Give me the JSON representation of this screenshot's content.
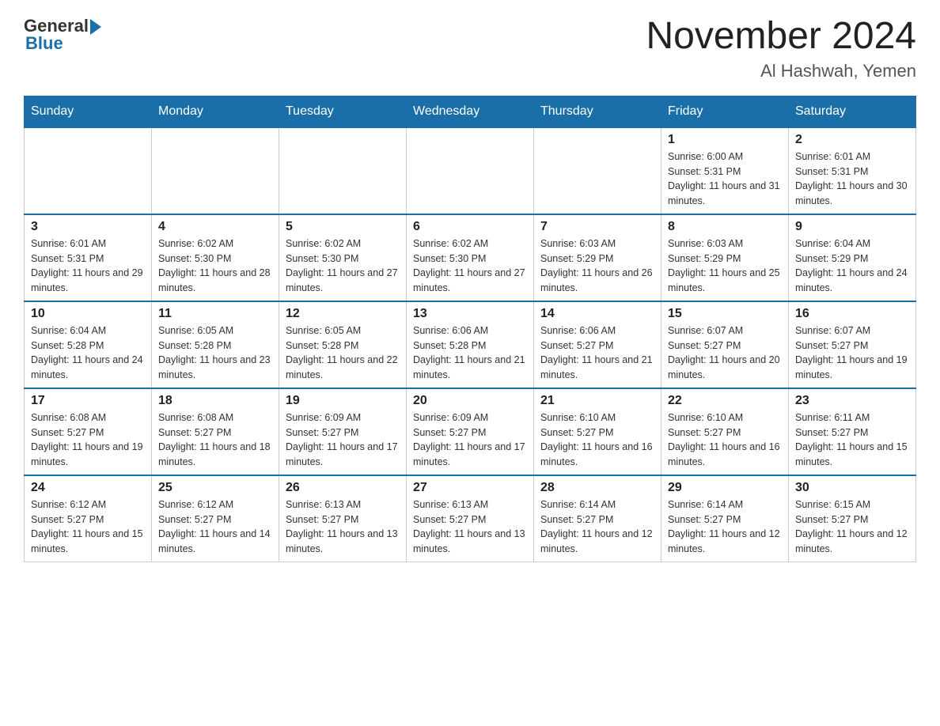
{
  "header": {
    "logo_general": "General",
    "logo_blue": "Blue",
    "title": "November 2024",
    "subtitle": "Al Hashwah, Yemen"
  },
  "days_of_week": [
    "Sunday",
    "Monday",
    "Tuesday",
    "Wednesday",
    "Thursday",
    "Friday",
    "Saturday"
  ],
  "weeks": [
    [
      {
        "day": "",
        "info": ""
      },
      {
        "day": "",
        "info": ""
      },
      {
        "day": "",
        "info": ""
      },
      {
        "day": "",
        "info": ""
      },
      {
        "day": "",
        "info": ""
      },
      {
        "day": "1",
        "info": "Sunrise: 6:00 AM\nSunset: 5:31 PM\nDaylight: 11 hours and 31 minutes."
      },
      {
        "day": "2",
        "info": "Sunrise: 6:01 AM\nSunset: 5:31 PM\nDaylight: 11 hours and 30 minutes."
      }
    ],
    [
      {
        "day": "3",
        "info": "Sunrise: 6:01 AM\nSunset: 5:31 PM\nDaylight: 11 hours and 29 minutes."
      },
      {
        "day": "4",
        "info": "Sunrise: 6:02 AM\nSunset: 5:30 PM\nDaylight: 11 hours and 28 minutes."
      },
      {
        "day": "5",
        "info": "Sunrise: 6:02 AM\nSunset: 5:30 PM\nDaylight: 11 hours and 27 minutes."
      },
      {
        "day": "6",
        "info": "Sunrise: 6:02 AM\nSunset: 5:30 PM\nDaylight: 11 hours and 27 minutes."
      },
      {
        "day": "7",
        "info": "Sunrise: 6:03 AM\nSunset: 5:29 PM\nDaylight: 11 hours and 26 minutes."
      },
      {
        "day": "8",
        "info": "Sunrise: 6:03 AM\nSunset: 5:29 PM\nDaylight: 11 hours and 25 minutes."
      },
      {
        "day": "9",
        "info": "Sunrise: 6:04 AM\nSunset: 5:29 PM\nDaylight: 11 hours and 24 minutes."
      }
    ],
    [
      {
        "day": "10",
        "info": "Sunrise: 6:04 AM\nSunset: 5:28 PM\nDaylight: 11 hours and 24 minutes."
      },
      {
        "day": "11",
        "info": "Sunrise: 6:05 AM\nSunset: 5:28 PM\nDaylight: 11 hours and 23 minutes."
      },
      {
        "day": "12",
        "info": "Sunrise: 6:05 AM\nSunset: 5:28 PM\nDaylight: 11 hours and 22 minutes."
      },
      {
        "day": "13",
        "info": "Sunrise: 6:06 AM\nSunset: 5:28 PM\nDaylight: 11 hours and 21 minutes."
      },
      {
        "day": "14",
        "info": "Sunrise: 6:06 AM\nSunset: 5:27 PM\nDaylight: 11 hours and 21 minutes."
      },
      {
        "day": "15",
        "info": "Sunrise: 6:07 AM\nSunset: 5:27 PM\nDaylight: 11 hours and 20 minutes."
      },
      {
        "day": "16",
        "info": "Sunrise: 6:07 AM\nSunset: 5:27 PM\nDaylight: 11 hours and 19 minutes."
      }
    ],
    [
      {
        "day": "17",
        "info": "Sunrise: 6:08 AM\nSunset: 5:27 PM\nDaylight: 11 hours and 19 minutes."
      },
      {
        "day": "18",
        "info": "Sunrise: 6:08 AM\nSunset: 5:27 PM\nDaylight: 11 hours and 18 minutes."
      },
      {
        "day": "19",
        "info": "Sunrise: 6:09 AM\nSunset: 5:27 PM\nDaylight: 11 hours and 17 minutes."
      },
      {
        "day": "20",
        "info": "Sunrise: 6:09 AM\nSunset: 5:27 PM\nDaylight: 11 hours and 17 minutes."
      },
      {
        "day": "21",
        "info": "Sunrise: 6:10 AM\nSunset: 5:27 PM\nDaylight: 11 hours and 16 minutes."
      },
      {
        "day": "22",
        "info": "Sunrise: 6:10 AM\nSunset: 5:27 PM\nDaylight: 11 hours and 16 minutes."
      },
      {
        "day": "23",
        "info": "Sunrise: 6:11 AM\nSunset: 5:27 PM\nDaylight: 11 hours and 15 minutes."
      }
    ],
    [
      {
        "day": "24",
        "info": "Sunrise: 6:12 AM\nSunset: 5:27 PM\nDaylight: 11 hours and 15 minutes."
      },
      {
        "day": "25",
        "info": "Sunrise: 6:12 AM\nSunset: 5:27 PM\nDaylight: 11 hours and 14 minutes."
      },
      {
        "day": "26",
        "info": "Sunrise: 6:13 AM\nSunset: 5:27 PM\nDaylight: 11 hours and 13 minutes."
      },
      {
        "day": "27",
        "info": "Sunrise: 6:13 AM\nSunset: 5:27 PM\nDaylight: 11 hours and 13 minutes."
      },
      {
        "day": "28",
        "info": "Sunrise: 6:14 AM\nSunset: 5:27 PM\nDaylight: 11 hours and 12 minutes."
      },
      {
        "day": "29",
        "info": "Sunrise: 6:14 AM\nSunset: 5:27 PM\nDaylight: 11 hours and 12 minutes."
      },
      {
        "day": "30",
        "info": "Sunrise: 6:15 AM\nSunset: 5:27 PM\nDaylight: 11 hours and 12 minutes."
      }
    ]
  ]
}
